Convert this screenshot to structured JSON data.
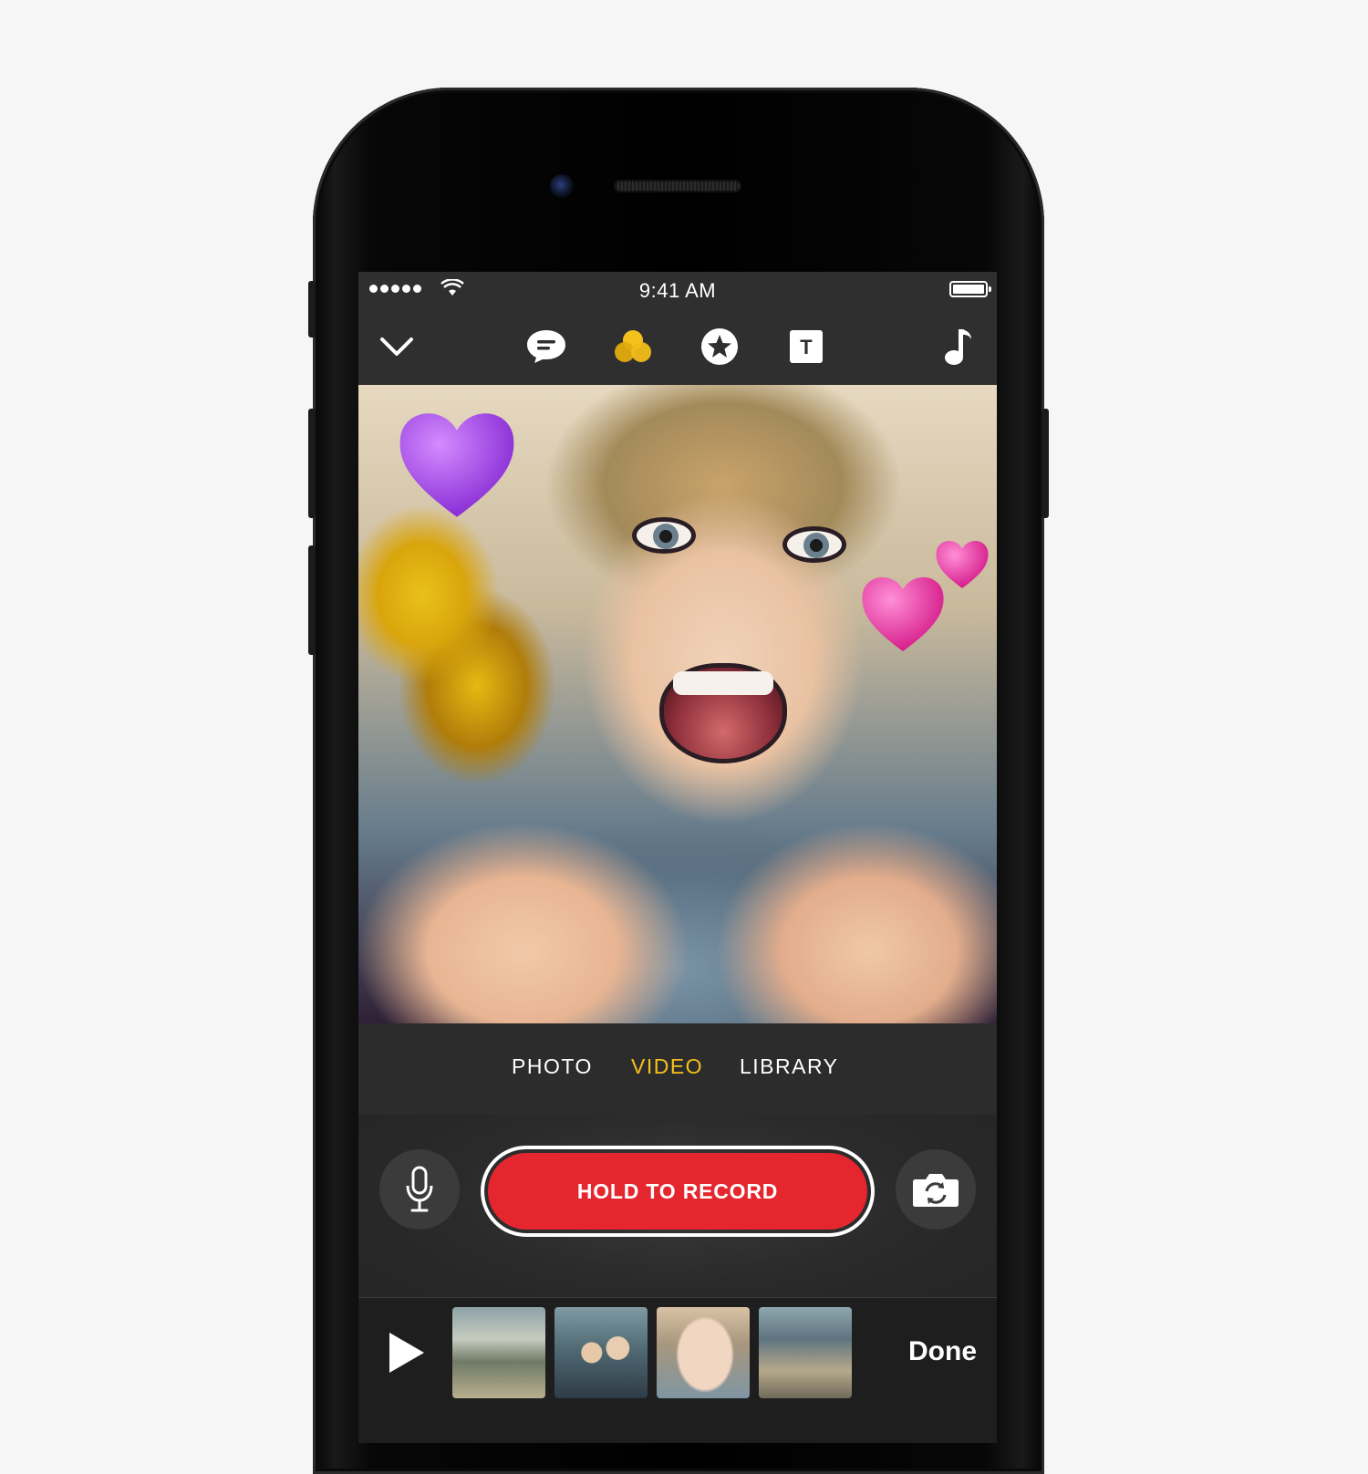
{
  "status_bar": {
    "time": "9:41 AM"
  },
  "toolbar": {
    "items": [
      {
        "icon": "chevron-down-icon"
      },
      {
        "icon": "speech-bubble-icon"
      },
      {
        "icon": "filters-icon",
        "active_color": "#f3c21c"
      },
      {
        "icon": "star-icon"
      },
      {
        "icon": "text-icon",
        "glyph": "T"
      },
      {
        "icon": "music-note-icon"
      }
    ]
  },
  "modes": {
    "items": [
      "PHOTO",
      "VIDEO",
      "LIBRARY"
    ],
    "selected": "VIDEO"
  },
  "record": {
    "label": "HOLD TO RECORD"
  },
  "timeline": {
    "done_label": "Done"
  },
  "colors": {
    "accent": "#f3c21c",
    "record": "#e5262f",
    "background": "#2c2c2c"
  }
}
